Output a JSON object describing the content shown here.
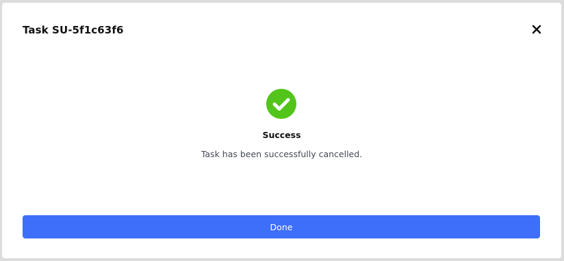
{
  "modal": {
    "title": "Task SU-5f1c63f6",
    "close_icon": "close-icon",
    "status": {
      "icon": "check-circle-icon",
      "icon_color": "#52c41a",
      "heading": "Success",
      "message": "Task has been successfully cancelled."
    },
    "done_label": "Done",
    "done_color": "#3d6ffb"
  }
}
